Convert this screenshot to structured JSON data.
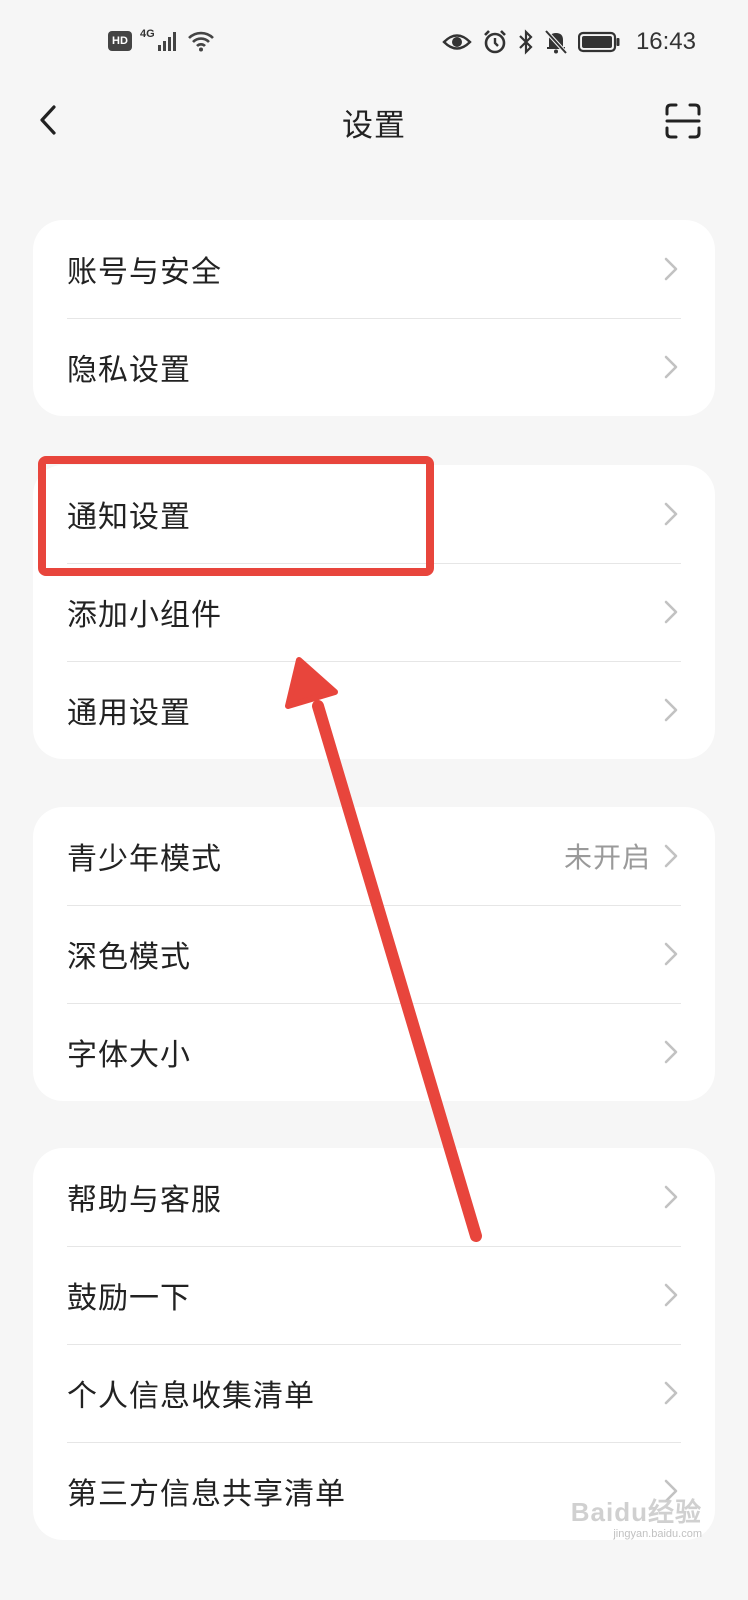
{
  "status_bar": {
    "hd_badge": "HD",
    "network": "4G",
    "time": "16:43",
    "icons": [
      "hd-icon",
      "signal-icon",
      "wifi-icon",
      "eye-icon",
      "alarm-icon",
      "bluetooth-icon",
      "bell-off-icon",
      "battery-icon"
    ]
  },
  "header": {
    "title": "设置",
    "back_icon": "chevron-left-icon",
    "scan_icon": "scan-icon"
  },
  "groups": [
    {
      "items": [
        {
          "label": "账号与安全"
        },
        {
          "label": "隐私设置"
        }
      ]
    },
    {
      "items": [
        {
          "label": "通知设置"
        },
        {
          "label": "添加小组件"
        },
        {
          "label": "通用设置"
        }
      ]
    },
    {
      "items": [
        {
          "label": "青少年模式",
          "value": "未开启"
        },
        {
          "label": "深色模式"
        },
        {
          "label": "字体大小"
        }
      ]
    },
    {
      "items": [
        {
          "label": "帮助与客服"
        },
        {
          "label": "鼓励一下"
        },
        {
          "label": "个人信息收集清单"
        },
        {
          "label": "第三方信息共享清单"
        }
      ]
    }
  ],
  "annotation": {
    "color": "#e8453c",
    "target": "通知设置"
  },
  "watermark": {
    "text": "Baidu经验",
    "sub": "jingyan.baidu.com"
  }
}
